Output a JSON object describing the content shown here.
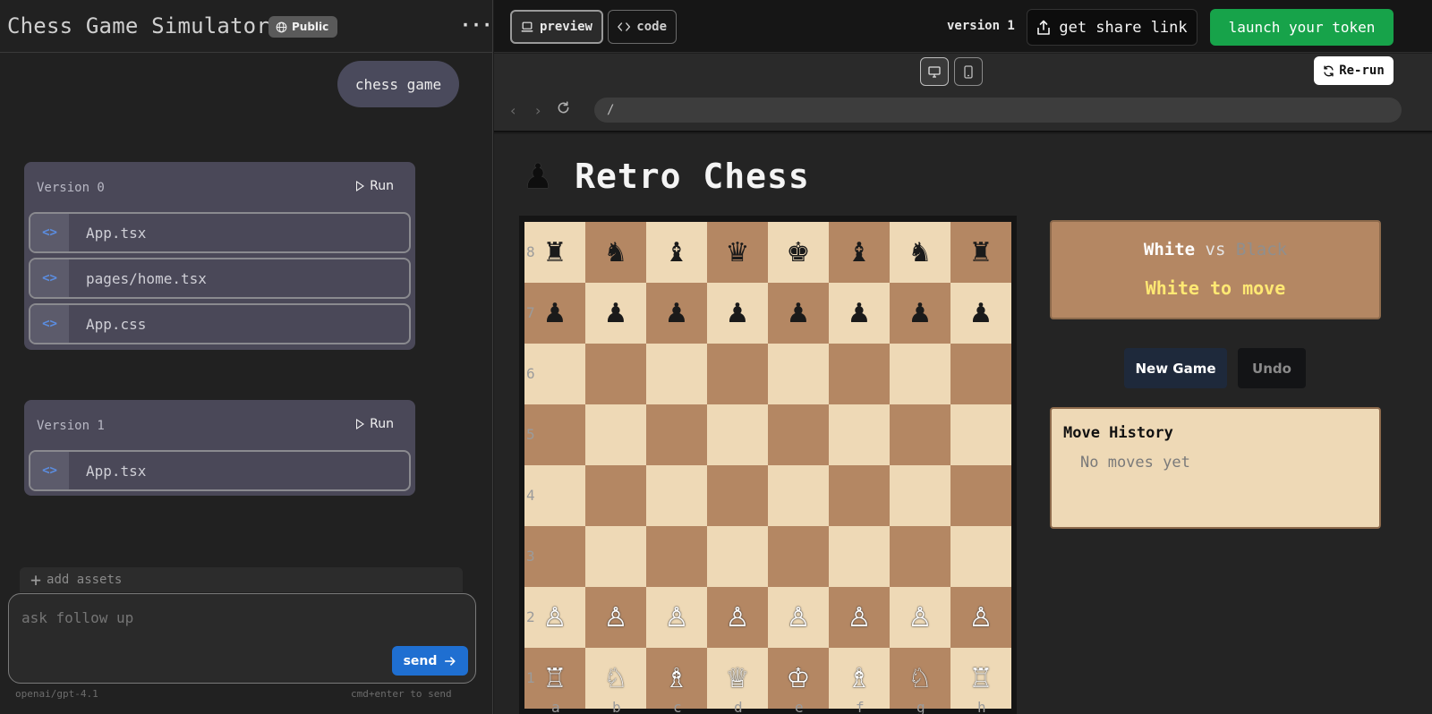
{
  "sidebar": {
    "title": "Chess Game Simulator",
    "badge": "Public",
    "user_message": "chess game",
    "versions": [
      {
        "title": "Version 0",
        "run_label": "Run",
        "files": [
          "App.tsx",
          "pages/home.tsx",
          "App.css"
        ]
      },
      {
        "title": "Version 1",
        "run_label": "Run",
        "files": [
          "App.tsx"
        ]
      }
    ],
    "add_assets_label": "add assets",
    "followup_placeholder": "ask follow up",
    "send_label": "send",
    "model": "openai/gpt-4.1",
    "hint": "cmd+enter to send"
  },
  "topbar": {
    "tabs": [
      "preview",
      "code"
    ],
    "version_label": "version 1",
    "share_label": "get share link",
    "launch_label": "launch your token",
    "rerun_label": "Re-run",
    "url": "/"
  },
  "game": {
    "heading_icon": "♟",
    "heading": "Retro Chess",
    "player_white": "White",
    "vs": "vs",
    "player_black": "Black",
    "turn": "White to move",
    "new_game_label": "New Game",
    "undo_label": "Undo",
    "history_title": "Move History",
    "history_empty": "No moves yet",
    "files": [
      "a",
      "b",
      "c",
      "d",
      "e",
      "f",
      "g",
      "h"
    ],
    "ranks": [
      "8",
      "7",
      "6",
      "5",
      "4",
      "3",
      "2",
      "1"
    ],
    "board": [
      [
        "r",
        "n",
        "b",
        "q",
        "k",
        "b",
        "n",
        "r"
      ],
      [
        "p",
        "p",
        "p",
        "p",
        "p",
        "p",
        "p",
        "p"
      ],
      [
        "",
        "",
        "",
        "",
        "",
        "",
        "",
        ""
      ],
      [
        "",
        "",
        "",
        "",
        "",
        "",
        "",
        ""
      ],
      [
        "",
        "",
        "",
        "",
        "",
        "",
        "",
        ""
      ],
      [
        "",
        "",
        "",
        "",
        "",
        "",
        "",
        ""
      ],
      [
        "P",
        "P",
        "P",
        "P",
        "P",
        "P",
        "P",
        "P"
      ],
      [
        "R",
        "N",
        "B",
        "Q",
        "K",
        "B",
        "N",
        "R"
      ]
    ],
    "colors": {
      "light_square": "#eed9b6",
      "dark_square": "#b48763",
      "turn_text": "#ffe873"
    }
  }
}
